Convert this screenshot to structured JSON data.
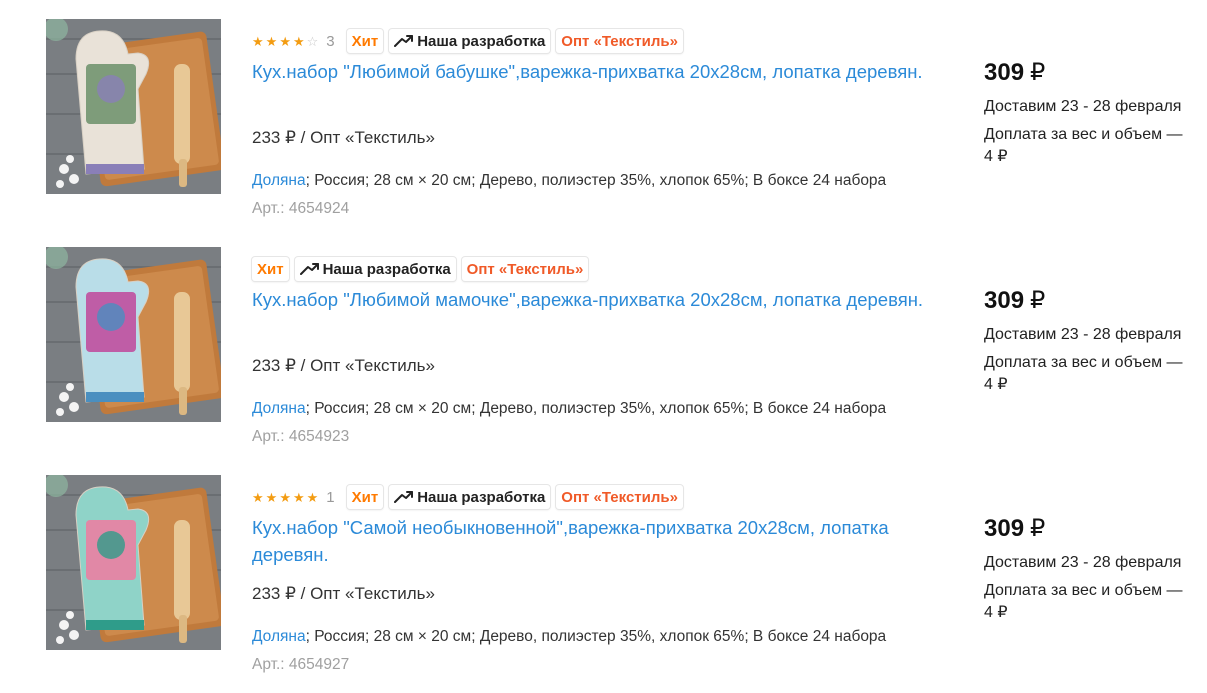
{
  "products": [
    {
      "rating": 4,
      "rating_count": "3",
      "badges": {
        "hit": "Хит",
        "dev": "Наша разработка",
        "opt": "Опт «Текстиль»"
      },
      "title": "Кух.набор \"Любимой бабушке\",варежка-прихватка 20х28см, лопатка деревян.",
      "opt_price": "233 ₽ / Опт «Текстиль»",
      "brand": "Доляна",
      "attrs": "; Россия; 28 см × 20 см; Дерево, полиэстер 35%, хлопок 65%; В боксе 24 набора",
      "sku": "Арт.: 4654924",
      "price": "309",
      "currency": "₽",
      "delivery": "Доставим 23 - 28 февраля",
      "surcharge": "Доплата за вес и объем — 4 ₽",
      "image": {
        "name": "kitchen-set-babushka-image",
        "mitt_color": "#e9e2d8",
        "print_color": "#6b8f6a",
        "accent": "#8a7fb8"
      }
    },
    {
      "rating": null,
      "rating_count": "",
      "badges": {
        "hit": "Хит",
        "dev": "Наша разработка",
        "opt": "Опт «Текстиль»"
      },
      "title": "Кух.набор \"Любимой мамочке\",варежка-прихватка 20х28см, лопатка деревян.",
      "opt_price": "233 ₽ / Опт «Текстиль»",
      "brand": "Доляна",
      "attrs": "; Россия; 28 см × 20 см; Дерево, полиэстер 35%, хлопок 65%; В боксе 24 набора",
      "sku": "Арт.: 4654923",
      "price": "309",
      "currency": "₽",
      "delivery": "Доставим 23 - 28 февраля",
      "surcharge": "Доплата за вес и объем — 4 ₽",
      "image": {
        "name": "kitchen-set-mamochka-image",
        "mitt_color": "#b9dde8",
        "print_color": "#c0479a",
        "accent": "#4a8fc0"
      }
    },
    {
      "rating": 5,
      "rating_count": "1",
      "badges": {
        "hit": "Хит",
        "dev": "Наша разработка",
        "opt": "Опт «Текстиль»"
      },
      "title": "Кух.набор \"Самой необыкновенной\",варежка-прихватка 20х28см, лопатка деревян.",
      "opt_price": "233 ₽ / Опт «Текстиль»",
      "brand": "Доляна",
      "attrs": "; Россия; 28 см × 20 см; Дерево, полиэстер 35%, хлопок 65%; В боксе 24 набора",
      "sku": "Арт.: 4654927",
      "price": "309",
      "currency": "₽",
      "delivery": "Доставим 23 - 28 февраля",
      "surcharge": "Доплата за вес и объем — 4 ₽",
      "image": {
        "name": "kitchen-set-neobyknovennoy-image",
        "mitt_color": "#8fd3c8",
        "print_color": "#f07aa0",
        "accent": "#2f9c8a"
      }
    }
  ],
  "colors": {
    "link": "#2b8ad8",
    "hit": "#ff7a00",
    "opt": "#f05a28",
    "star": "#f39c12"
  },
  "icons": {
    "dev_badge": "handshake-arrow-icon",
    "star": "star-icon"
  }
}
